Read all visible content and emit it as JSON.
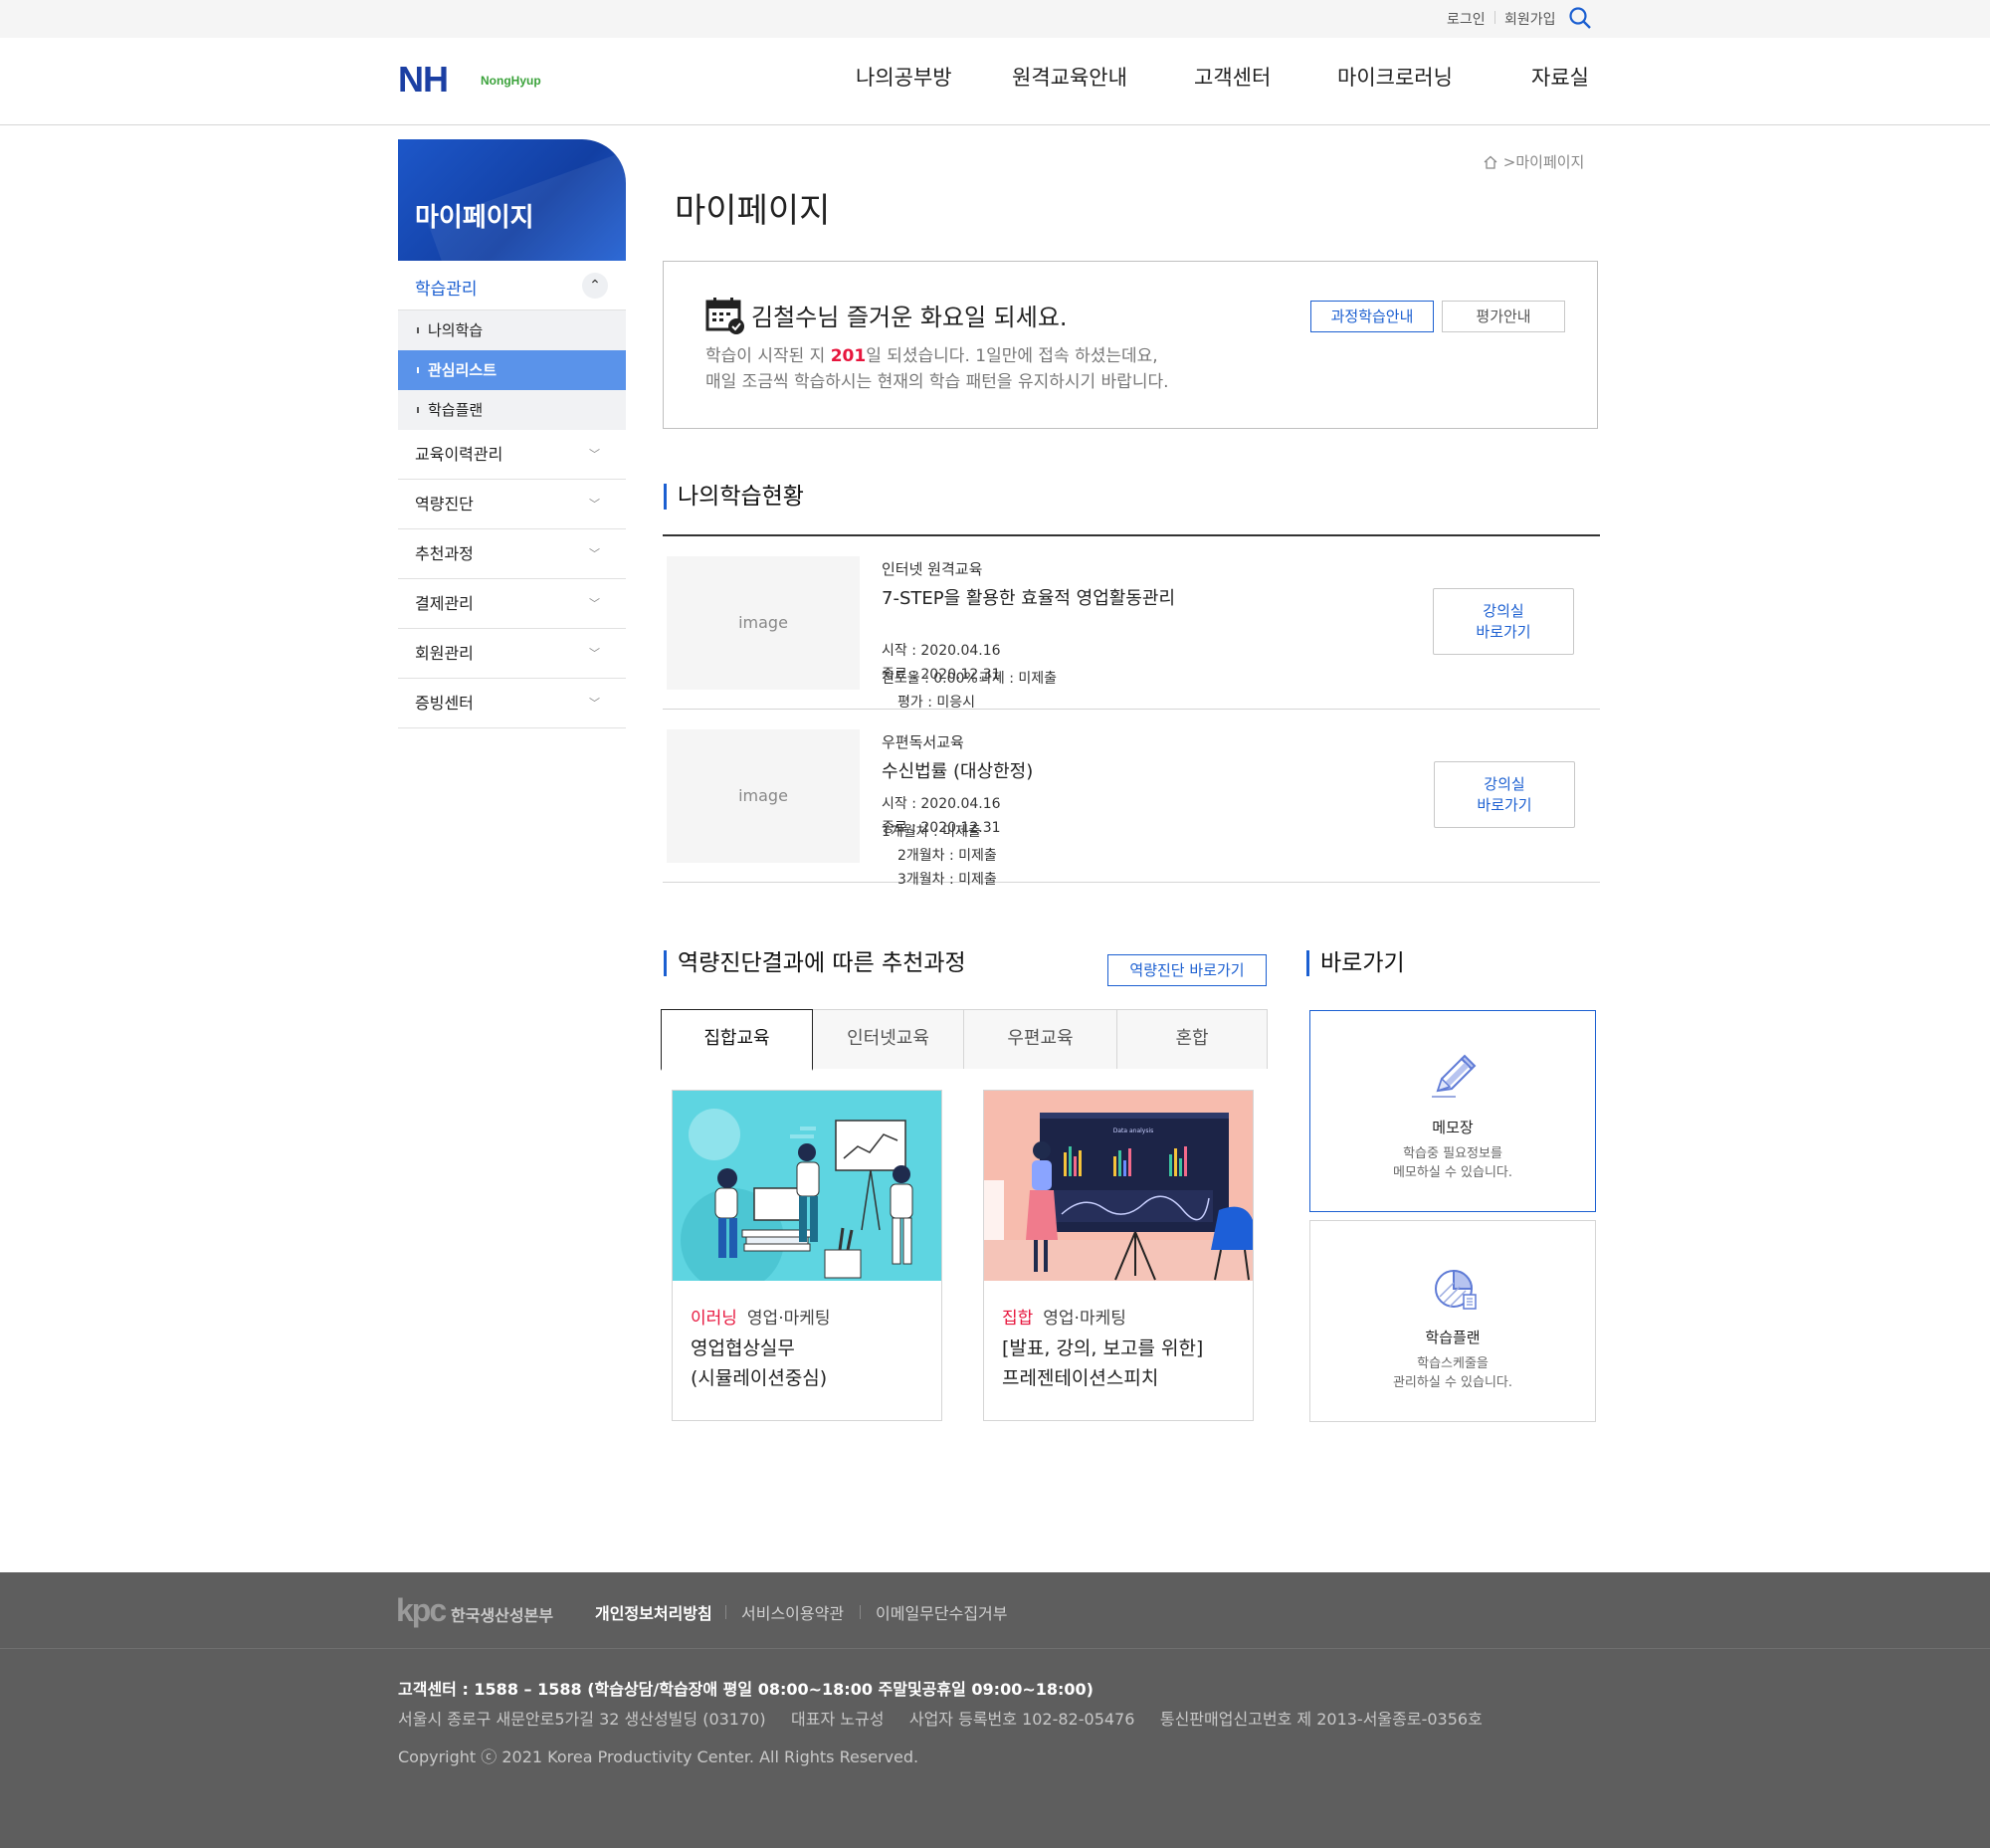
{
  "top_links": {
    "login": "로그인",
    "join": "회원가입"
  },
  "header": {
    "logo_main": "NH",
    "logo_sub": "NongHyup",
    "nav": [
      "나의공부방",
      "원격교육안내",
      "고객센터",
      "마이크로러닝",
      "자료실"
    ]
  },
  "sidebar": {
    "title": "마이페이지",
    "open_group": "학습관리",
    "sub_items": [
      "나의학습",
      "관심리스트",
      "학습플랜"
    ],
    "groups": [
      "교육이력관리",
      "역량진단",
      "추천과정",
      "결제관리",
      "회원관리",
      "증빙센터"
    ]
  },
  "breadcrumb": {
    "current": ">마이페이지"
  },
  "page_title": "마이페이지",
  "greeting": {
    "title": "김철수님 즐거운 화요일 되세요.",
    "line1_pre": "학습이 시작된 지 ",
    "days": "201",
    "line1_post": "일 되셨습니다. 1일만에 접속 하셨는데요,",
    "line2": "매일 조금씩 학습하시는 현재의 학습 패턴을 유지하시기 바랍니다.",
    "btn_course": "과정학습안내",
    "btn_eval": "평가안내"
  },
  "status": {
    "title": "나의학습현황",
    "courses": [
      {
        "thumb": "image",
        "kind": "인터넷 원격교육",
        "name": "7-STEP을 활용한 효율적 영업활동관리",
        "start": "시작 : 2020.04.16",
        "end": "종료 : 2020.12.31",
        "progress": "진도율 : 0.00%",
        "task": "과제 : 미제출",
        "eval": "평가 : 미응시",
        "go": "강의실",
        "go2": "바로가기"
      },
      {
        "thumb": "image",
        "kind": "우편독서교육",
        "name": "수신법률 (대상한정)",
        "start": "시작 : 2020.04.16",
        "end": "종료 : 2020.12.31",
        "m1": "1개월차 : 미제출",
        "m2": "2개월차 : 미제출",
        "m3": "3개월차 : 미제출",
        "go": "강의실",
        "go2": "바로가기"
      }
    ]
  },
  "recommend": {
    "title": "역량진단결과에 따른 추천과정",
    "btn": "역량진단 바로가기",
    "tabs": [
      "집합교육",
      "인터넷교육",
      "우편교육",
      "혼합"
    ],
    "cards": [
      {
        "type": "이러닝",
        "cat": "영업·마케팅",
        "title1": "영업협상실무",
        "title2": "(시뮬레이션중심)"
      },
      {
        "type": "집합",
        "cat": "영업·마케팅",
        "title1": "[발표, 강의, 보고를 위한]",
        "title2": "프레젠테이션스피치",
        "chart_label": "Data analysis"
      }
    ]
  },
  "shortcuts": {
    "title": "바로가기",
    "items": [
      {
        "title": "메모장",
        "desc1": "학습중 필요정보를",
        "desc2": "메모하실 수 있습니다."
      },
      {
        "title": "학습플랜",
        "desc1": "학습스케줄을",
        "desc2": "관리하실 수 있습니다."
      }
    ]
  },
  "footer": {
    "org": "한국생산성본부",
    "links": [
      "개인정보처리방침",
      "서비스이용약관",
      "이메일무단수집거부"
    ],
    "cs": "고객센터 : 1588 – 1588 (학습상담/학습장애  평일 08:00~18:00 주말및공휴일 09:00~18:00)",
    "addr": "서울시 종로구 새문안로5가길 32 생산성빌딩 (03170)     대표자 노규성     사업자 등록번호 102-82-05476     통신판매업신고번호 제 2013-서울종로-0356호",
    "copy": "Copyright ⓒ 2021 Korea Productivity Center. All Rights Reserved."
  },
  "colors": {
    "accent": "#1b5fd1",
    "highlight": "#e7163d",
    "sidebar_active": "#5a93ea",
    "footer_bg": "#5e5e5e"
  }
}
